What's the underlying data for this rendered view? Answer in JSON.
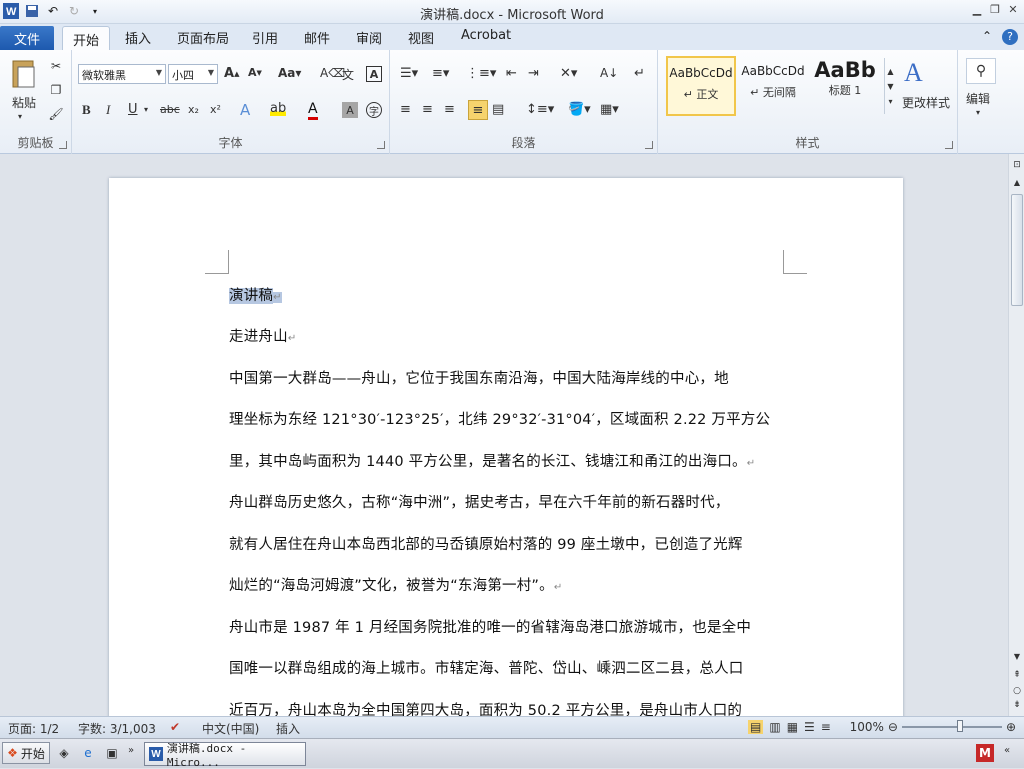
{
  "window": {
    "title": "演讲稿.docx - Microsoft Word"
  },
  "tabs": {
    "file": "文件",
    "items": [
      "开始",
      "插入",
      "页面布局",
      "引用",
      "邮件",
      "审阅",
      "视图",
      "Acrobat"
    ],
    "active": "开始"
  },
  "ribbon": {
    "clipboard": {
      "label": "剪贴板",
      "paste": "粘贴"
    },
    "font": {
      "label": "字体",
      "family": "微软雅黑",
      "size": "小四"
    },
    "paragraph": {
      "label": "段落"
    },
    "styles": {
      "label": "样式",
      "items": [
        {
          "sample": "AaBbCcDd",
          "name": "↵ 正文"
        },
        {
          "sample": "AaBbCcDd",
          "name": "↵ 无间隔"
        },
        {
          "sample": "AaBb",
          "name": "标题 1"
        }
      ],
      "change": "更改样式"
    },
    "editing": {
      "label": "编辑"
    }
  },
  "document": {
    "title": "演讲稿",
    "lines": [
      "走进舟山",
      "中国第一大群岛——舟山，它位于我国东南沿海，中国大陆海岸线的中心，地",
      "理坐标为东经 121°30′-123°25′，北纬 29°32′-31°04′，区域面积 2.22 万平方公",
      "里，其中岛屿面积为 1440 平方公里，是著名的长江、钱塘江和甬江的出海口。",
      "舟山群岛历史悠久，古称“海中洲”，据史考古，早在六千年前的新石器时代，",
      "就有人居住在舟山本岛西北部的马岙镇原始村落的 99 座土墩中，已创造了光辉",
      "灿烂的“海岛河姆渡”文化，被誉为“东海第一村”。",
      "舟山市是 1987 年 1 月经国务院批准的唯一的省辖海岛港口旅游城市，也是全中",
      "国唯一以群岛组成的海上城市。市辖定海、普陀、岱山、嵊泗二区二县，总人口",
      "近百万，舟山本岛为全中国第四大岛，面积为 50.2 平方公里，是舟山市人口的"
    ]
  },
  "status": {
    "page": "页面: 1/2",
    "words": "字数: 3/1,003",
    "language": "中文(中国)",
    "mode": "插入",
    "zoom": "100%"
  },
  "taskbar": {
    "start": "开始",
    "task": "演讲稿.docx - Micro..."
  }
}
